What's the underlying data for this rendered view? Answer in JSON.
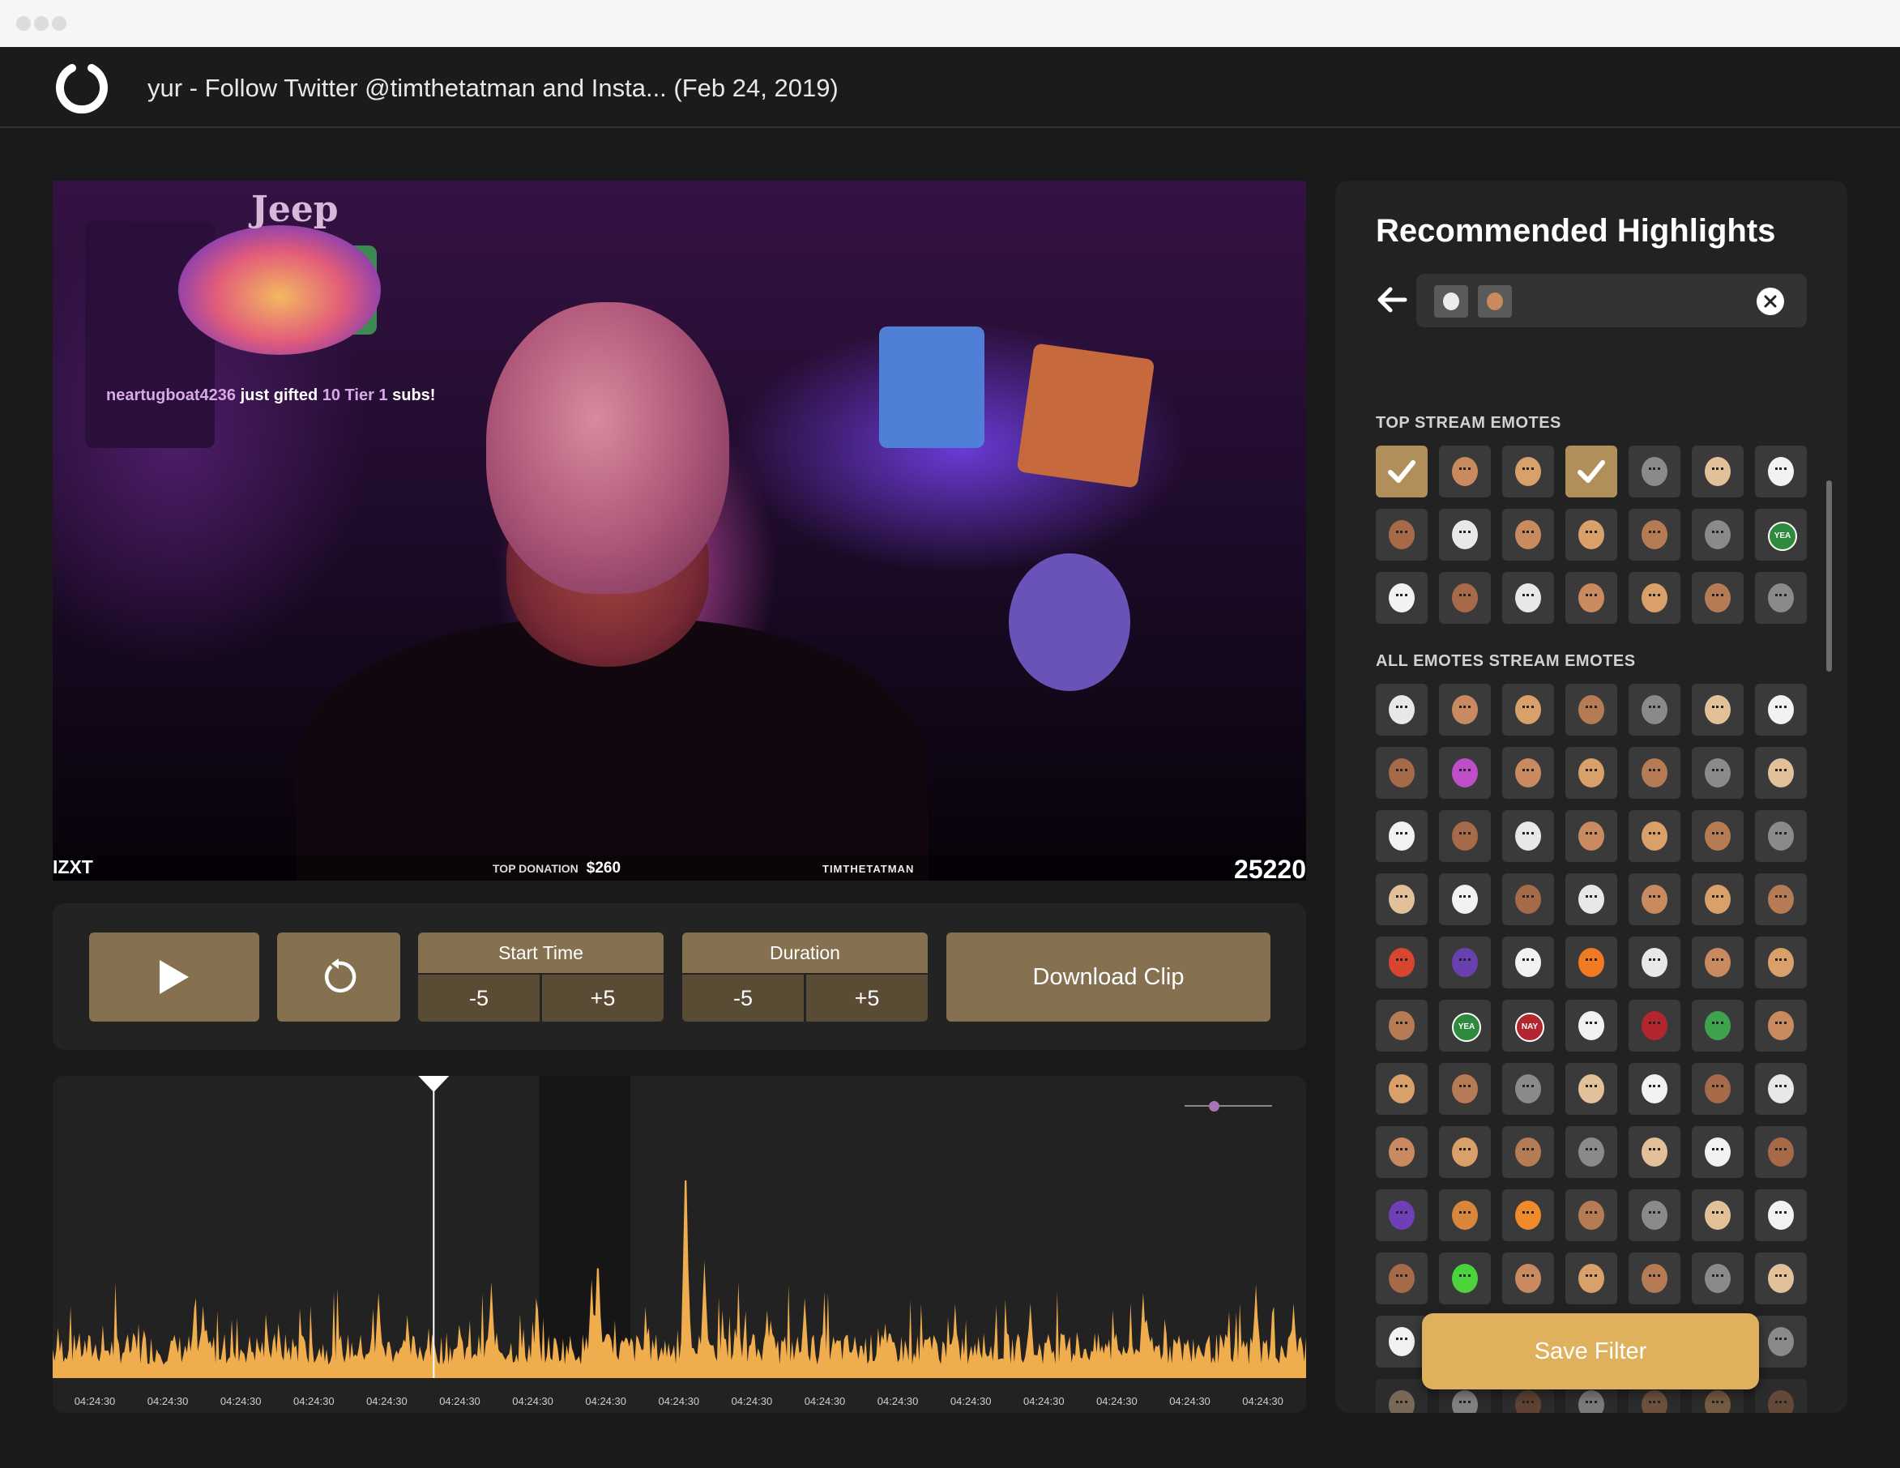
{
  "window": {
    "title": "yur - Follow Twitter @timthetatman and Insta... (Feb 24, 2019)"
  },
  "video": {
    "overlay_brand_top": "Jeep",
    "alert_user": "neartugboat4236",
    "alert_text_1": " just gifted ",
    "alert_text_2": "10 Tier 1",
    "alert_text_3": " subs!",
    "left_ticker": "IZXT",
    "donation_label": "TOP DONATION",
    "donation_amount": "$260",
    "brand_label": "TIMTHETATMAN",
    "counter": "25220"
  },
  "controls": {
    "play_icon": "play-icon",
    "reset_icon": "reset-icon",
    "start_time": {
      "label": "Start Time",
      "minus": "-5",
      "plus": "+5"
    },
    "duration": {
      "label": "Duration",
      "minus": "-5",
      "plus": "+5"
    },
    "download_label": "Download Clip"
  },
  "timeline": {
    "tick_labels": [
      "04:24:30",
      "04:24:30",
      "04:24:30",
      "04:24:30",
      "04:24:30",
      "04:24:30",
      "04:24:30",
      "04:24:30",
      "04:24:30",
      "04:24:30",
      "04:24:30",
      "04:24:30",
      "04:24:30",
      "04:24:30",
      "04:24:30",
      "04:24:30",
      "04:24:30"
    ],
    "playhead_fraction": 0.304,
    "selection_start_fraction": 0.388,
    "selection_end_fraction": 0.461,
    "zoom_level_fraction": 0.3,
    "activity_color": "#f0ad4e"
  },
  "panel": {
    "title": "Recommended Highlights",
    "active_filters": [
      "emote-face-white",
      "emote-face-person"
    ],
    "top_label": "TOP STREAM EMOTES",
    "all_label": "ALL EMOTES STREAM EMOTES",
    "top_emotes": [
      {
        "icon": "check-icon",
        "selected": true
      },
      {
        "icon": "skull-icon"
      },
      {
        "icon": "face-icon"
      },
      {
        "icon": "check-icon",
        "selected": true
      },
      {
        "icon": "police-car-icon"
      },
      {
        "icon": "face-icon"
      },
      {
        "icon": "penguin-icon"
      },
      {
        "icon": "face-icon"
      },
      {
        "icon": "box-icon"
      },
      {
        "icon": "face-icon"
      },
      {
        "icon": "yeet-icon"
      },
      {
        "icon": "face-icon"
      },
      {
        "icon": "face-icon"
      },
      {
        "icon": "yea-badge-icon",
        "badge": "YEA"
      },
      {
        "icon": "face-icon"
      },
      {
        "icon": "face-icon"
      },
      {
        "icon": "face-icon"
      },
      {
        "icon": "face-icon"
      },
      {
        "icon": "face-icon"
      },
      {
        "icon": "face-icon"
      },
      {
        "icon": "face-icon"
      }
    ],
    "all_emotes": [
      {
        "icon": "face-icon"
      },
      {
        "icon": "skull-icon"
      },
      {
        "icon": "face-icon"
      },
      {
        "icon": "face-icon"
      },
      {
        "icon": "face-icon"
      },
      {
        "icon": "face-icon"
      },
      {
        "icon": "panda-icon"
      },
      {
        "icon": "face-icon"
      },
      {
        "icon": "rainbow-icon"
      },
      {
        "icon": "face-icon"
      },
      {
        "icon": "face-icon"
      },
      {
        "icon": "face-icon"
      },
      {
        "icon": "salt-icon"
      },
      {
        "icon": "face-icon"
      },
      {
        "icon": "face-icon"
      },
      {
        "icon": "dog-icon"
      },
      {
        "icon": "face-icon"
      },
      {
        "icon": "face-icon"
      },
      {
        "icon": "face-icon"
      },
      {
        "icon": "face-icon"
      },
      {
        "icon": "face-icon"
      },
      {
        "icon": "face-icon"
      },
      {
        "icon": "face-icon"
      },
      {
        "icon": "face-icon"
      },
      {
        "icon": "face-icon"
      },
      {
        "icon": "face-icon"
      },
      {
        "icon": "face-icon"
      },
      {
        "icon": "face-icon"
      },
      {
        "icon": "cross-icon"
      },
      {
        "icon": "blob-icon"
      },
      {
        "icon": "paper-icon"
      },
      {
        "icon": "fire-icon"
      },
      {
        "icon": "cat-icon"
      },
      {
        "icon": "face-icon"
      },
      {
        "icon": "face-icon"
      },
      {
        "icon": "face-icon"
      },
      {
        "icon": "yea-badge-icon",
        "badge": "YEA"
      },
      {
        "icon": "nay-badge-icon",
        "badge": "NAY"
      },
      {
        "icon": "rocket-icon"
      },
      {
        "icon": "raid-icon"
      },
      {
        "icon": "creeper-icon"
      },
      {
        "icon": "face-icon"
      },
      {
        "icon": "pyramid-icon"
      },
      {
        "icon": "face-icon"
      },
      {
        "icon": "face-icon"
      },
      {
        "icon": "face-icon"
      },
      {
        "icon": "face-icon"
      },
      {
        "icon": "face-icon"
      },
      {
        "icon": "dog-icon"
      },
      {
        "icon": "face-icon"
      },
      {
        "icon": "face-icon"
      },
      {
        "icon": "well-played-icon"
      },
      {
        "icon": "face-icon"
      },
      {
        "icon": "face-icon"
      },
      {
        "icon": "face-icon"
      },
      {
        "icon": "face-icon"
      },
      {
        "icon": "can-icon"
      },
      {
        "icon": "tornado-icon"
      },
      {
        "icon": "pizza-icon"
      },
      {
        "icon": "face-icon"
      },
      {
        "icon": "face-icon"
      },
      {
        "icon": "dog-icon"
      },
      {
        "icon": "face-icon"
      },
      {
        "icon": "face-icon"
      },
      {
        "icon": "alien-icon"
      },
      {
        "icon": "face-icon"
      },
      {
        "icon": "face-icon"
      },
      {
        "icon": "face-icon"
      },
      {
        "icon": "face-icon"
      },
      {
        "icon": "face-icon"
      },
      {
        "icon": "face-icon"
      },
      {
        "icon": "face-icon"
      },
      {
        "icon": "face-icon"
      },
      {
        "icon": "face-icon"
      },
      {
        "icon": "face-icon"
      },
      {
        "icon": "face-icon"
      },
      {
        "icon": "face-icon"
      },
      {
        "icon": "face-icon",
        "faded": true
      },
      {
        "icon": "face-icon",
        "faded": true
      },
      {
        "icon": "kapow-icon",
        "faded": true
      },
      {
        "icon": "face-icon",
        "faded": true
      },
      {
        "icon": "face-icon",
        "faded": true
      },
      {
        "icon": "face-icon",
        "faded": true
      },
      {
        "icon": "face-icon",
        "faded": true
      }
    ],
    "save_label": "Save Filter"
  },
  "colors": {
    "accent": "#857150",
    "accent_dark": "#5a4b35",
    "save": "#e0b15c",
    "activity": "#f0ad4e",
    "panel_bg": "#222222"
  }
}
